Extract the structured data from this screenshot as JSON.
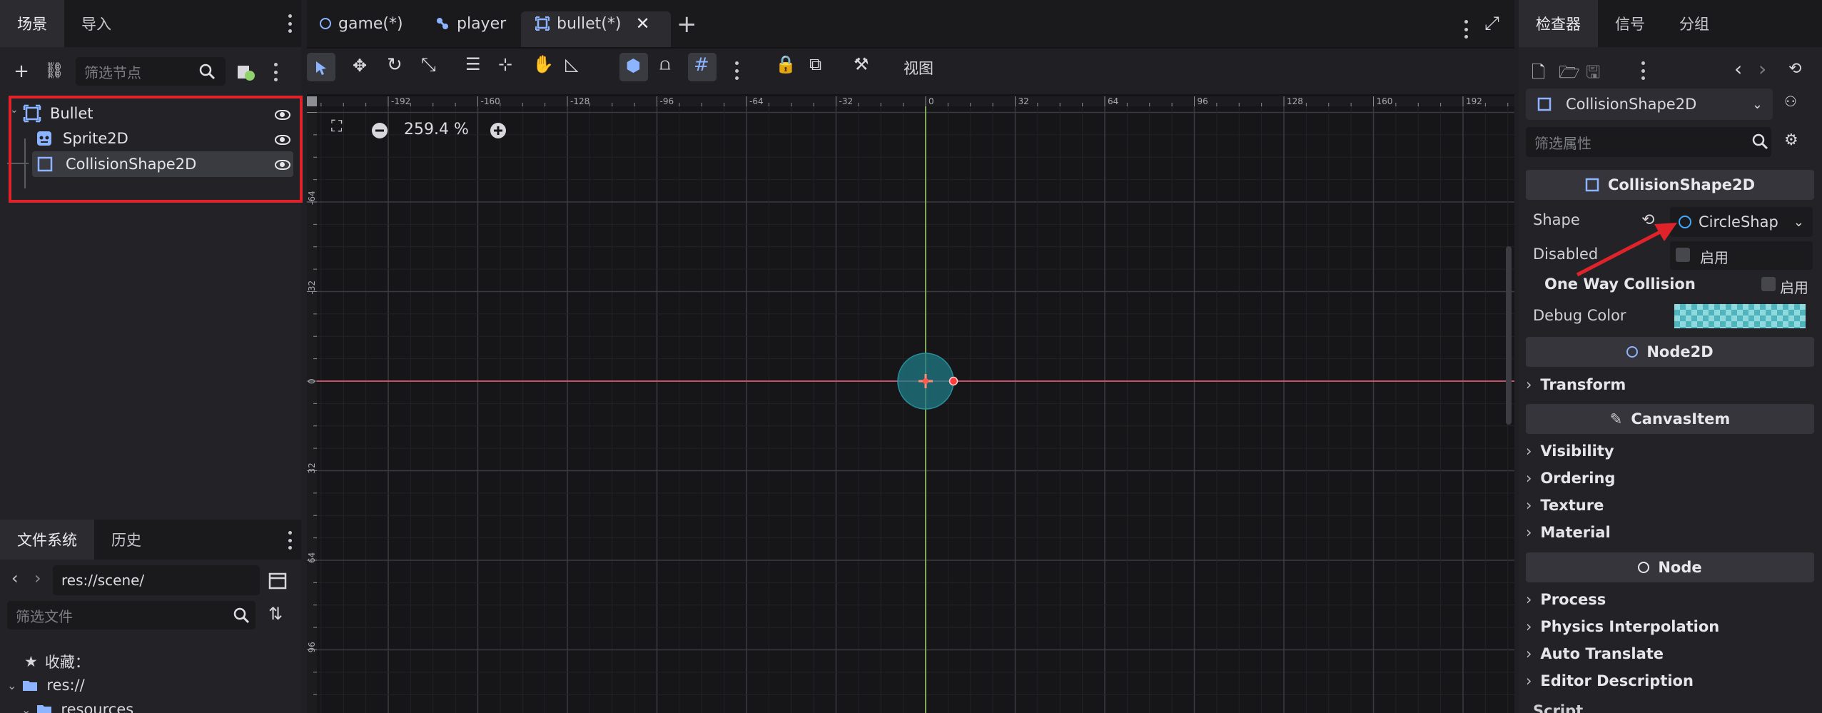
{
  "left_top_tabs": [
    {
      "label": "场景"
    },
    {
      "label": "导入"
    }
  ],
  "scene_filter": {
    "placeholder": "筛选节点"
  },
  "scene_tree": [
    {
      "label": "Bullet"
    },
    {
      "label": "Sprite2D"
    },
    {
      "label": "CollisionShape2D"
    }
  ],
  "left_bottom_tabs": [
    {
      "label": "文件系统"
    },
    {
      "label": "历史"
    }
  ],
  "filesystem": {
    "path": "res://scene/",
    "filter_placeholder": "筛选文件",
    "favorites_label": "收藏：",
    "res_label": "res://",
    "resources_label": "resources"
  },
  "scene_tabs": [
    {
      "label": "game(*)"
    },
    {
      "label": "player"
    },
    {
      "label": "bullet(*)"
    }
  ],
  "toolbar": {
    "view_label": "视图"
  },
  "viewport": {
    "zoom": "259.4 %"
  },
  "ruler": {
    "h_ticks": [
      "-192",
      "-160",
      "-128",
      "-96",
      "-64",
      "-32",
      "0",
      "32",
      "64",
      "96",
      "128",
      "160",
      "192"
    ],
    "v_ticks": [
      "-64",
      "-32",
      "0",
      "32",
      "64",
      "96"
    ]
  },
  "right_tabs": [
    {
      "label": "检查器"
    },
    {
      "label": "信号"
    },
    {
      "label": "分组"
    }
  ],
  "inspector": {
    "node_selector": "CollisionShape2D",
    "filter_placeholder": "筛选属性",
    "section_collision": "CollisionShape2D",
    "shape_label": "Shape",
    "shape_value": "CircleShap",
    "disabled_label": "Disabled",
    "enable_label": "启用",
    "one_way_label": "One Way Collision",
    "one_way_enable": "启用",
    "debug_color_label": "Debug Color",
    "section_node2d": "Node2D",
    "transform_label": "Transform",
    "section_canvas": "CanvasItem",
    "canvas_groups": [
      {
        "label": "Visibility"
      },
      {
        "label": "Ordering"
      },
      {
        "label": "Texture"
      },
      {
        "label": "Material"
      }
    ],
    "section_node": "Node",
    "node_groups": [
      {
        "label": "Process"
      },
      {
        "label": "Physics Interpolation"
      },
      {
        "label": "Auto Translate"
      },
      {
        "label": "Editor Description"
      }
    ],
    "script_label": "Script"
  },
  "colors": {
    "accent": "#4a8cf7",
    "highlight_box": "#e0232a",
    "arrow": "#e0232a",
    "shape_fill": "#1f7a86",
    "x_axis": "#c4506e",
    "y_axis": "#7fa85a"
  }
}
